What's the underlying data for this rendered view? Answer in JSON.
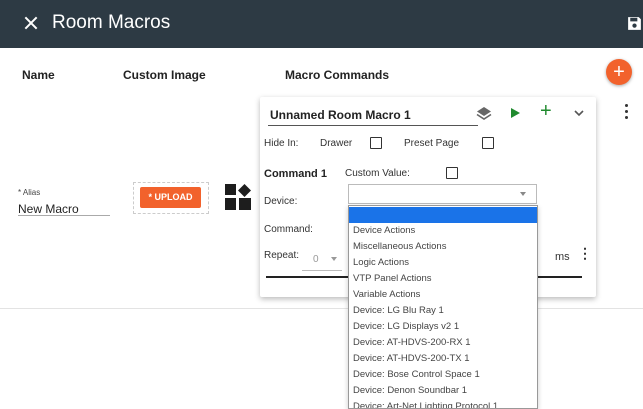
{
  "header": {
    "title": "Room Macros",
    "close_icon": "close-icon",
    "save_icon": "save-icon",
    "background": "#2d3a44"
  },
  "columns": {
    "name": "Name",
    "custom_image": "Custom Image",
    "macro_commands": "Macro Commands"
  },
  "add_button": {
    "label": "+",
    "color": "#f2622c"
  },
  "macro_row": {
    "alias_label": "* Alias",
    "alias_value": "New Macro",
    "upload_label": "* UPLOAD",
    "image_icon": "shapes-icon"
  },
  "macro_card": {
    "name": "Unnamed Room Macro 1",
    "hide_in_label": "Hide In:",
    "drawer_label": "Drawer",
    "preset_page_label": "Preset Page",
    "command_title": "Command 1",
    "custom_value_label": "Custom Value:",
    "device_label": "Device:",
    "command_label": "Command:",
    "repeat_label": "Repeat:",
    "repeat_value": "0",
    "ms_label": "ms",
    "accent_green": "#1f8a2e"
  },
  "device_dropdown": {
    "options": [
      "",
      "Device Actions",
      "Miscellaneous Actions",
      "Logic Actions",
      "VTP Panel Actions",
      "Variable Actions",
      "Device: LG Blu Ray 1",
      "Device: LG Displays v2 1",
      "Device: AT-HDVS-200-RX 1",
      "Device: AT-HDVS-200-TX 1",
      "Device: Bose Control Space 1",
      "Device: Denon Soundbar 1",
      "Device: Art-Net Lighting Protocol 1"
    ],
    "selected_index": 0,
    "highlight_color": "#1a73e8"
  }
}
